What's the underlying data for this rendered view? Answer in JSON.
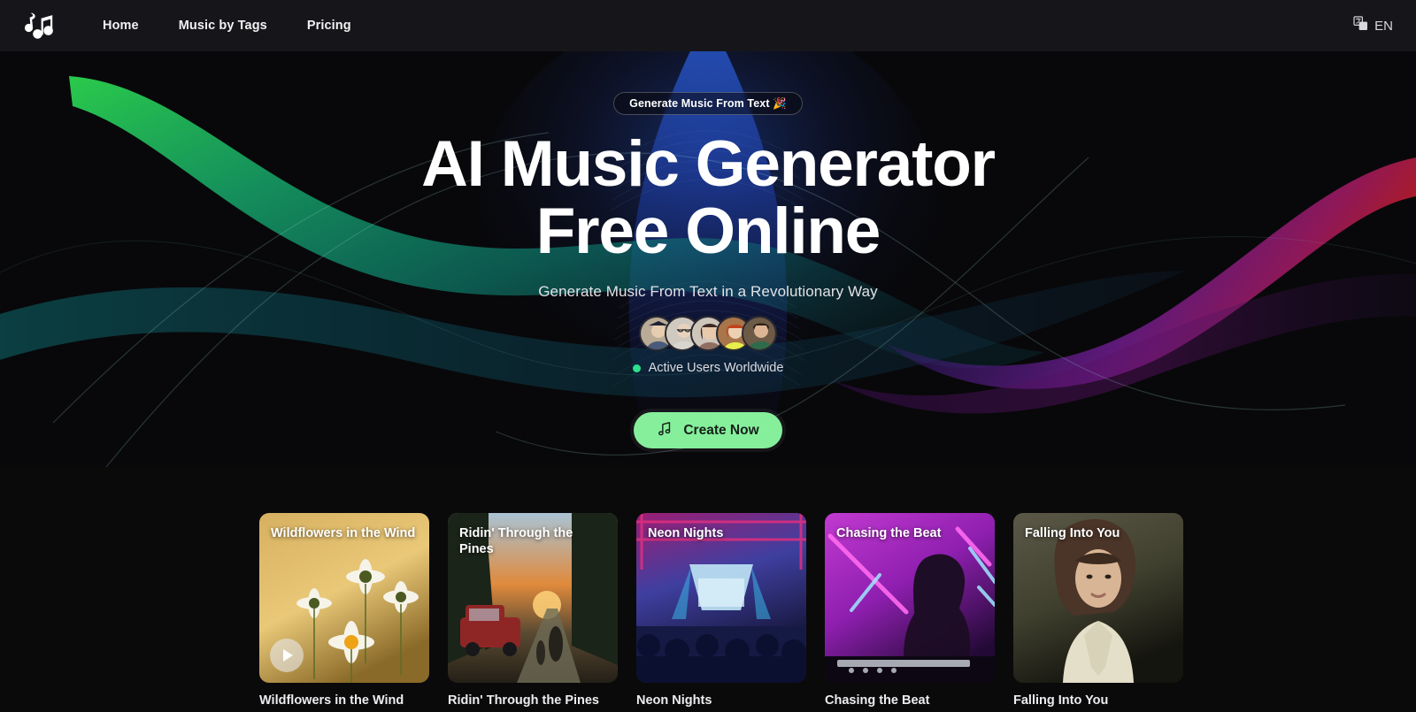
{
  "navbar": {
    "logo_icon": "music-notes-logo",
    "links": [
      {
        "label": "Home"
      },
      {
        "label": "Music by Tags"
      },
      {
        "label": "Pricing"
      }
    ],
    "language": {
      "icon": "translate-icon",
      "label": "EN"
    }
  },
  "hero": {
    "badge": "Generate Music From Text 🎉",
    "title_line1": "AI Music Generator",
    "title_line2": "Free Online",
    "subtitle": "Generate Music From Text in a Revolutionary Way",
    "active_users_label": "Active Users Worldwide",
    "status_dot_color": "#2ee08a",
    "cta": {
      "label": "Create Now",
      "icon": "music-note-icon",
      "color": "#86ef9b"
    },
    "avatars": [
      {
        "name": "avatar-1"
      },
      {
        "name": "avatar-2"
      },
      {
        "name": "avatar-3"
      },
      {
        "name": "avatar-4"
      },
      {
        "name": "avatar-5"
      }
    ]
  },
  "cards": [
    {
      "title": "Wildflowers in the Wind",
      "label": "Wildflowers in the Wind",
      "has_play": true,
      "c1": "#caa24a",
      "c2": "#e0bc63",
      "c3": "#8a6a28"
    },
    {
      "title": "Ridin' Through the Pines",
      "label": "Ridin' Through the Pines",
      "has_play": false,
      "c1": "#9db9cc",
      "c2": "#c9772f",
      "c3": "#2b2b24"
    },
    {
      "title": "Neon Nights",
      "label": "Neon Nights",
      "has_play": false,
      "c1": "#b0217a",
      "c2": "#2b6fd0",
      "c3": "#14123a"
    },
    {
      "title": "Chasing the Beat",
      "label": "Chasing the Beat",
      "has_play": false,
      "c1": "#d13ad0",
      "c2": "#a01fb6",
      "c3": "#2a0b3a"
    },
    {
      "title": "Falling Into You",
      "label": "Falling Into You",
      "has_play": false,
      "c1": "#4c4a3c",
      "c2": "#6a5a48",
      "c3": "#14140f"
    }
  ]
}
